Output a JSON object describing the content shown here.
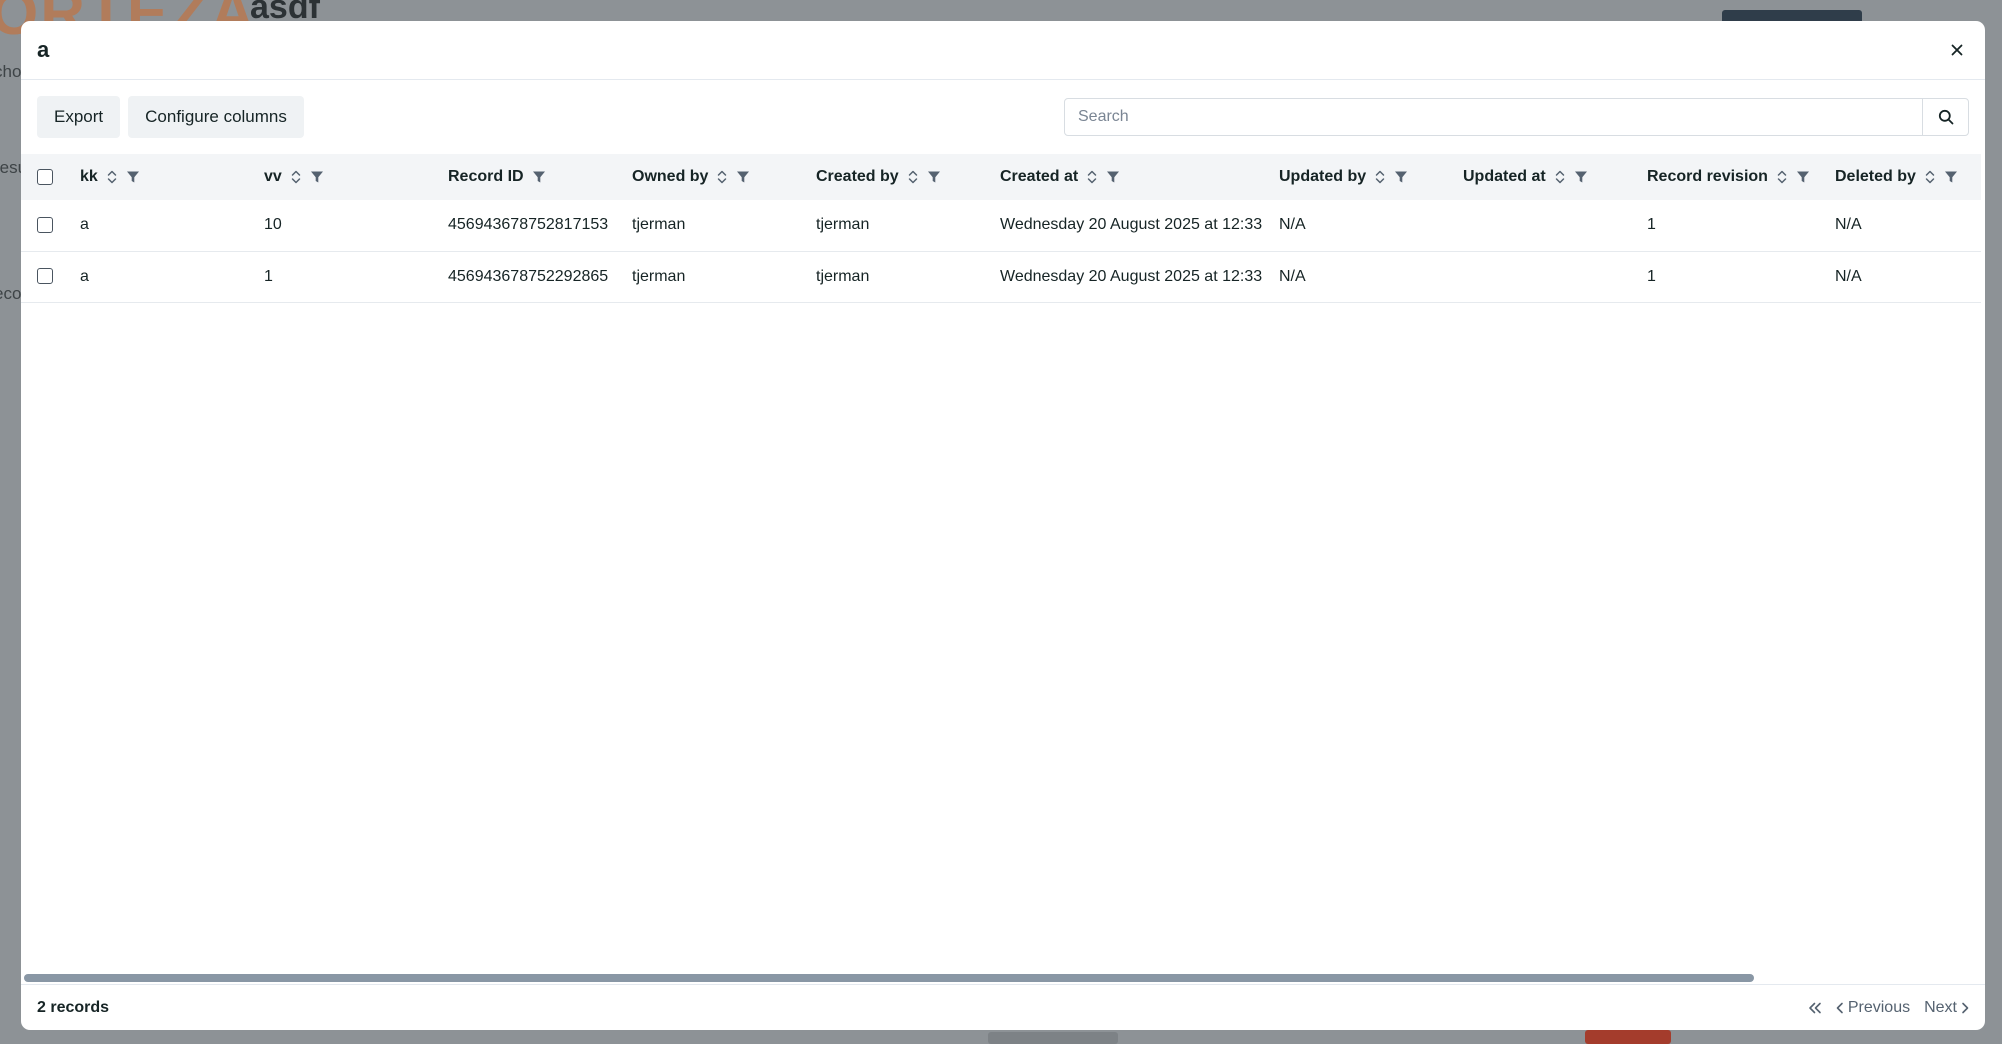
{
  "background": {
    "logo": "ORTEZA",
    "title": "asdf",
    "left_text_1": "cho",
    "left_text_2": "resu",
    "left_text_3": "eco"
  },
  "modal": {
    "title": "a",
    "close_label": "×"
  },
  "toolbar": {
    "export_label": "Export",
    "configure_label": "Configure columns",
    "search_placeholder": "Search"
  },
  "table": {
    "columns": [
      {
        "label": "kk",
        "sortable": true,
        "filterable": true
      },
      {
        "label": "vv",
        "sortable": true,
        "filterable": true
      },
      {
        "label": "Record ID",
        "sortable": false,
        "filterable": true
      },
      {
        "label": "Owned by",
        "sortable": true,
        "filterable": true
      },
      {
        "label": "Created by",
        "sortable": true,
        "filterable": true
      },
      {
        "label": "Created at",
        "sortable": true,
        "filterable": true
      },
      {
        "label": "Updated by",
        "sortable": true,
        "filterable": true
      },
      {
        "label": "Updated at",
        "sortable": true,
        "filterable": true
      },
      {
        "label": "Record revision",
        "sortable": true,
        "filterable": true
      },
      {
        "label": "Deleted by",
        "sortable": true,
        "filterable": true
      }
    ],
    "rows": [
      [
        "a",
        "10",
        "456943678752817153",
        "tjerman",
        "tjerman",
        "Wednesday 20 August 2025 at 12:33",
        "N/A",
        "",
        "1",
        "N/A"
      ],
      [
        "a",
        "1",
        "456943678752292865",
        "tjerman",
        "tjerman",
        "Wednesday 20 August 2025 at 12:33",
        "N/A",
        "",
        "1",
        "N/A"
      ]
    ]
  },
  "footer": {
    "count": "2 records",
    "previous": "Previous",
    "next": "Next"
  },
  "colors": {
    "overlay": "#8d9296",
    "header_bg": "#f3f5f7",
    "text": "#162425",
    "scrollbar": "#8997a5"
  }
}
